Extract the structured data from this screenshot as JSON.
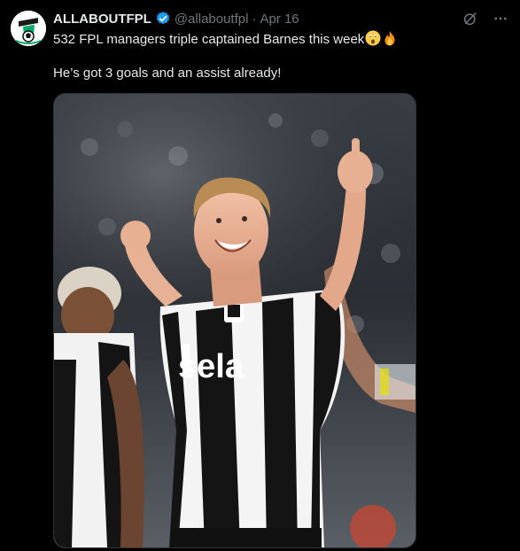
{
  "tweet": {
    "author_name": "ALLABOUTFPL",
    "handle": "@allaboutfpl",
    "separator": "·",
    "date": "Apr 16",
    "text_line1": "532 FPL managers triple captained Barnes this week",
    "text_line2": "He’s got 3 goals and an assist already!",
    "emojis": [
      "astonished-face-emoji",
      "fire-emoji"
    ]
  },
  "media": {
    "sponsor_text": "sela",
    "description_icon": "player-celebration-photo"
  },
  "colors": {
    "background": "#000000",
    "text": "#e7e9ea",
    "secondary": "#71767b",
    "verified": "#1d9bf0"
  }
}
